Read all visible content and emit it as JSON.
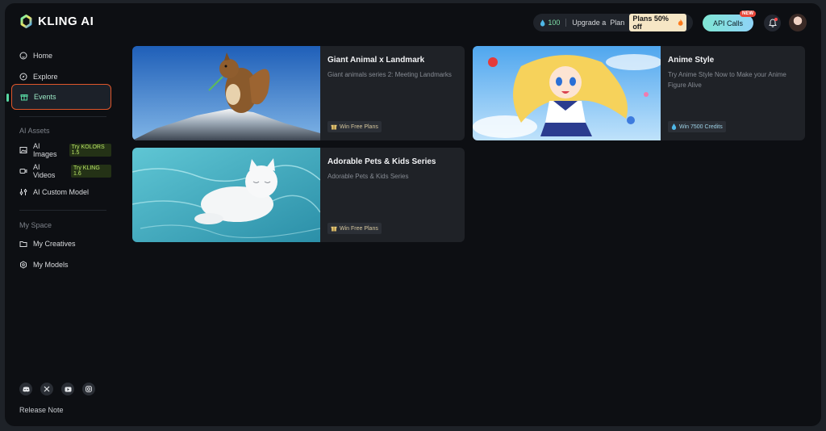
{
  "brand": {
    "name": "KLING AI"
  },
  "header": {
    "credits": "100",
    "upgrade_label": "Upgrade a  Plan",
    "promo_label": "Plans 50% off",
    "api_label": "API Calls",
    "new_badge": "NEW"
  },
  "sidebar": {
    "home": "Home",
    "explore": "Explore",
    "events": "Events",
    "assets_title": "AI Assets",
    "ai_images": "AI Images",
    "ai_images_badge": "Try KOLORS 1.5",
    "ai_videos": "AI Videos",
    "ai_videos_badge": "Try KLING 1.6",
    "custom_model": "AI Custom Model",
    "space_title": "My Space",
    "my_creatives": "My Creatives",
    "my_models": "My Models",
    "release_note": "Release Note"
  },
  "cards": [
    {
      "title": "Giant Animal x Landmark",
      "desc": "Giant animals series 2: Meeting Landmarks",
      "tag": "Win Free Plans"
    },
    {
      "title": "Anime Style",
      "desc": "Try Anime Style Now to Make your Anime Figure Alive",
      "tag": "Win 7500 Credits"
    },
    {
      "title": "Adorable Pets & Kids Series",
      "desc": "Adorable Pets & Kids Series",
      "tag": "Win Free Plans"
    }
  ],
  "colors": {
    "accent_green": "#57d6a1",
    "highlight_border": "#e0562a",
    "api_gradient": "#7fe6d4"
  }
}
